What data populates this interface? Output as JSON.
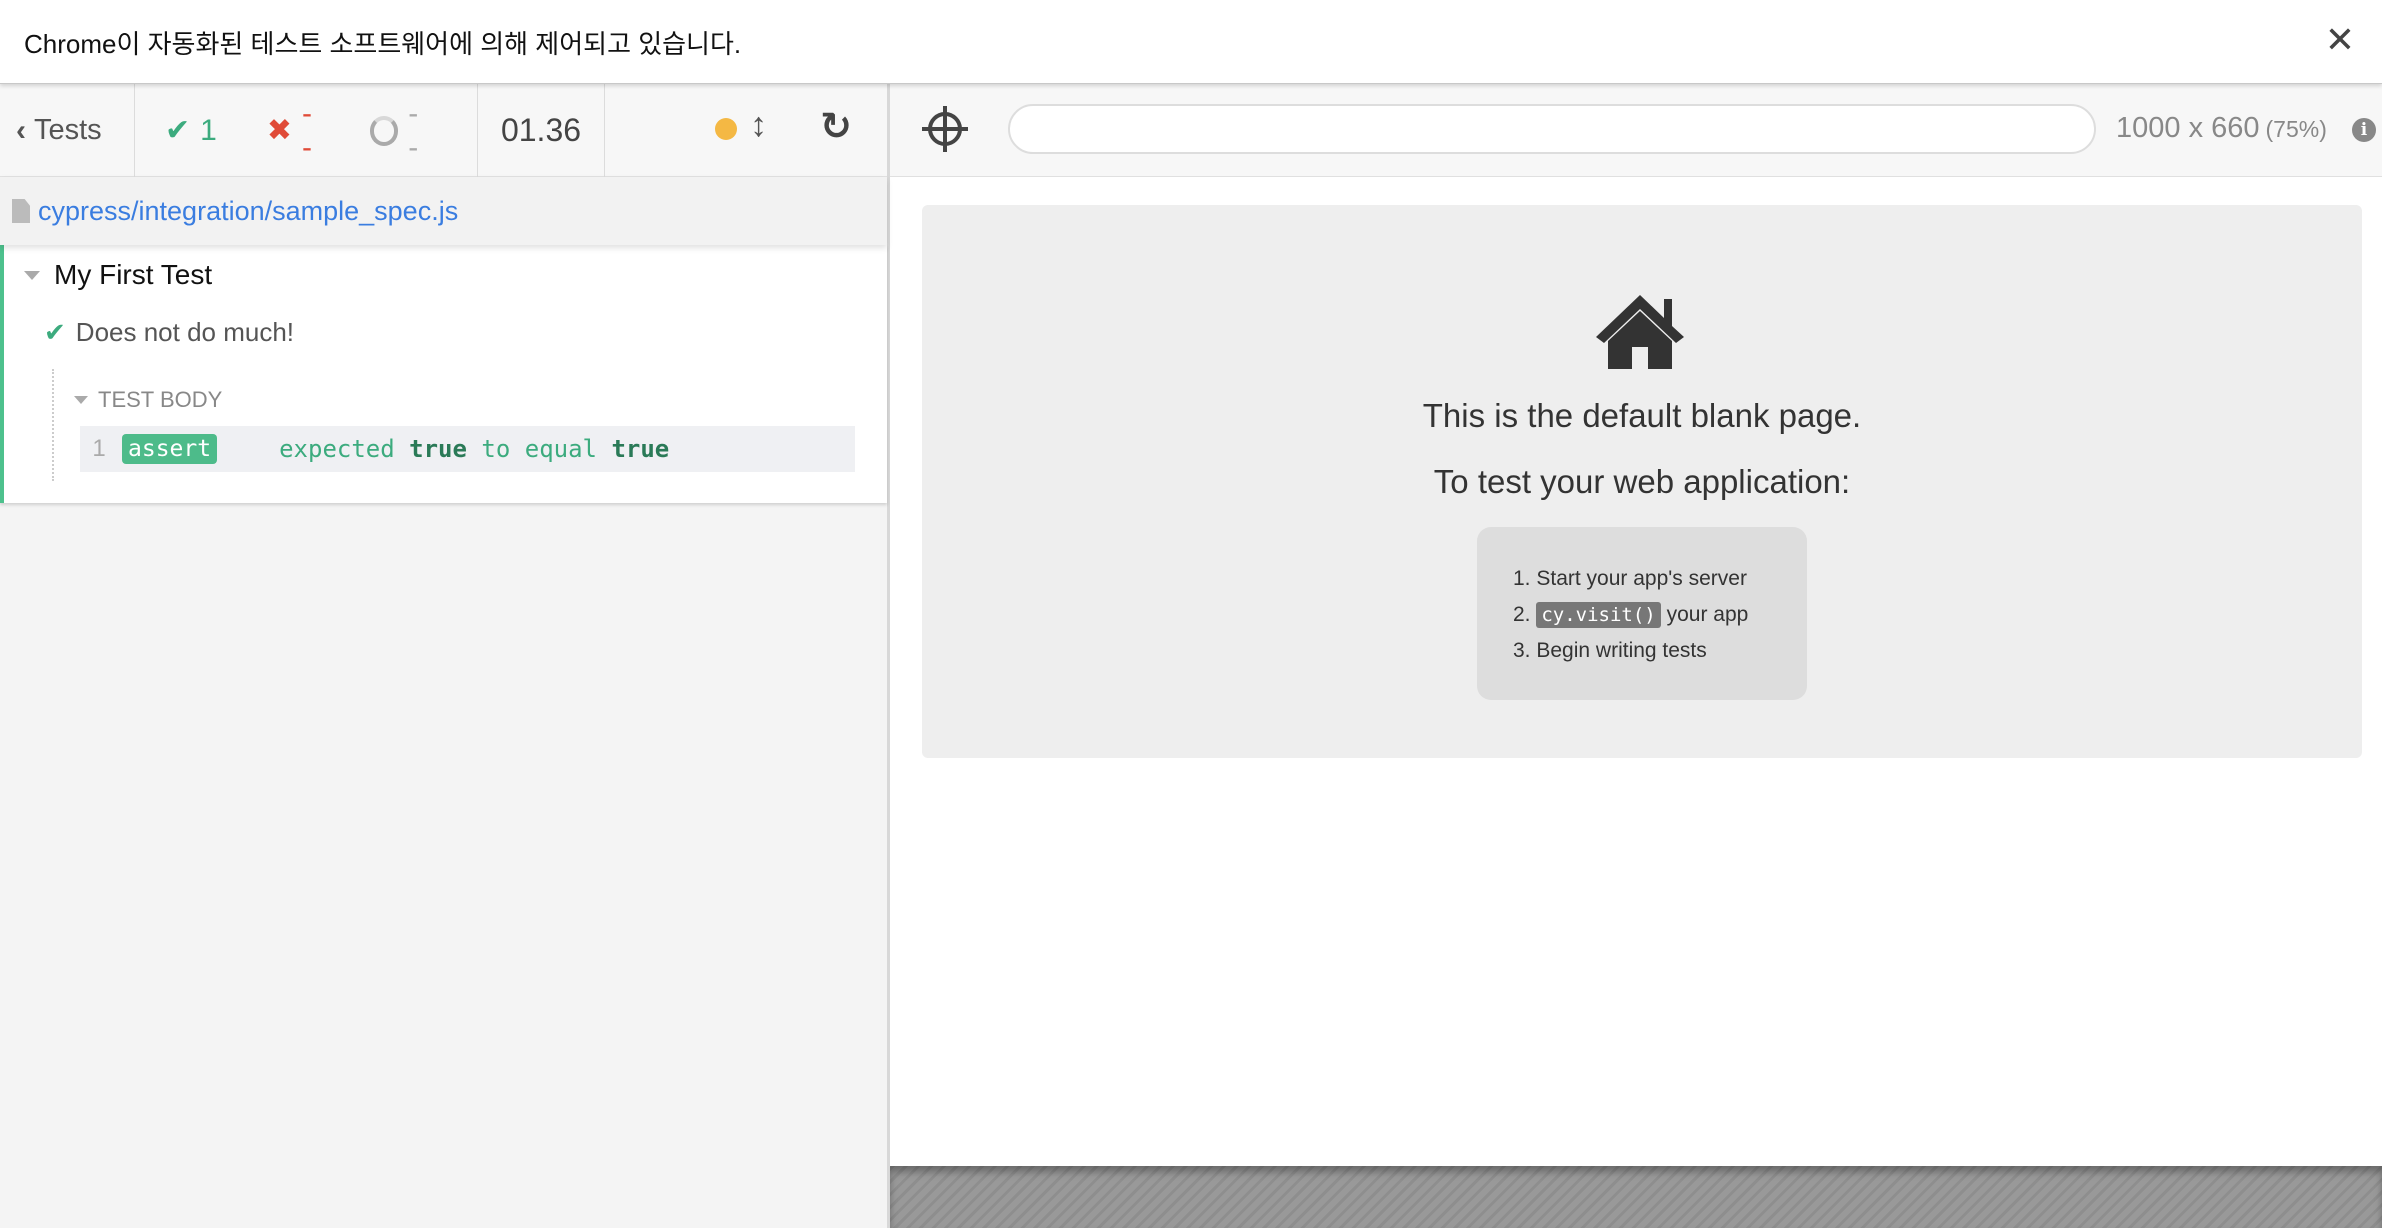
{
  "banner": {
    "text": "Chrome이 자동화된 테스트 소프트웨어에 의해 제어되고 있습니다.",
    "close_icon": "✕"
  },
  "reporter": {
    "tests_label": "Tests",
    "stats": {
      "passed": "1",
      "failed": "--",
      "pending": "--"
    },
    "duration": "01.36",
    "status_color": "#f4b844",
    "spec_file": "cypress/integration/sample_spec.js",
    "suite": {
      "title": "My First Test",
      "tests": [
        {
          "title": "Does not do much!",
          "state": "passed",
          "hook_label": "TEST BODY",
          "commands": [
            {
              "number": "1",
              "name": "assert",
              "message_parts": [
                "expected",
                "true",
                "to equal",
                "true"
              ]
            }
          ]
        }
      ]
    }
  },
  "runner": {
    "url_value": "",
    "viewport_size": "1000 x 660",
    "viewport_scale": "(75%)",
    "aut": {
      "title": "This is the default blank page.",
      "subtitle": "To test your web application:",
      "steps": [
        {
          "num": "1.",
          "text": "Start your app's server"
        },
        {
          "num": "2.",
          "code": "cy.visit()",
          "text": "your app"
        },
        {
          "num": "3.",
          "text": "Begin writing tests"
        }
      ]
    }
  },
  "colors": {
    "passed": "#3cab7e",
    "failed": "#e04b38",
    "pending": "#aaaaaa",
    "link": "#3a7de0"
  }
}
